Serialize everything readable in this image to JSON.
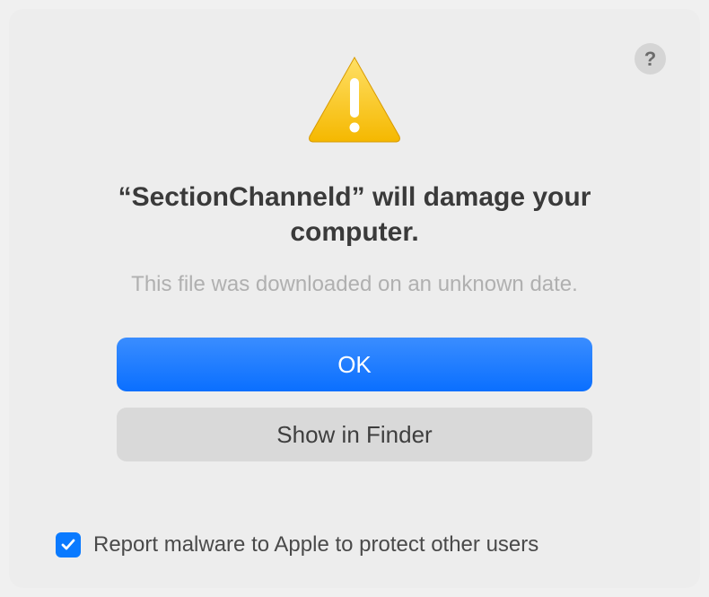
{
  "dialog": {
    "title": "“SectionChanneld” will damage your computer.",
    "subtitle": "This file was downloaded on an unknown date."
  },
  "buttons": {
    "ok": "OK",
    "showInFinder": "Show in Finder"
  },
  "checkbox": {
    "label": "Report malware to Apple to protect other users",
    "checked": true
  },
  "help": {
    "glyph": "?"
  }
}
